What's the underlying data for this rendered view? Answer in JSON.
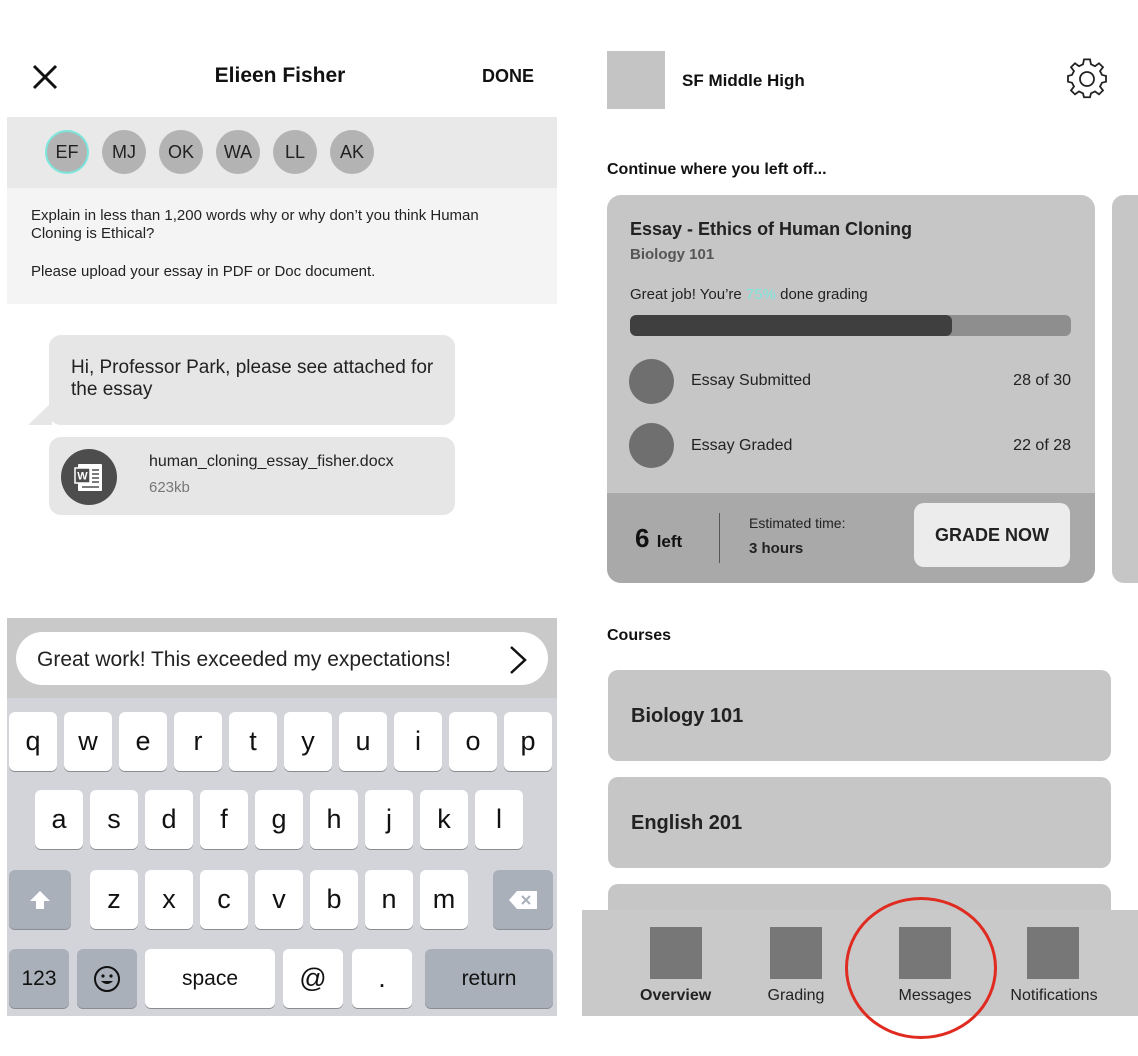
{
  "message_screen": {
    "header": {
      "title": "Elieen Fisher",
      "done_label": "DONE"
    },
    "participants": [
      {
        "initials": "EF",
        "active": true
      },
      {
        "initials": "MJ",
        "active": false
      },
      {
        "initials": "OK",
        "active": false
      },
      {
        "initials": "WA",
        "active": false
      },
      {
        "initials": "LL",
        "active": false
      },
      {
        "initials": "AK",
        "active": false
      }
    ],
    "prompt": {
      "line1": "Explain in less than 1,200 words why or why don’t you think Human Cloning is Ethical?",
      "line2": "Please upload your essay in PDF or Doc document."
    },
    "message": {
      "text": "Hi, Professor Park, please see attached for the essay"
    },
    "attachment": {
      "filename": "human_cloning_essay_fisher.docx",
      "size": "623kb",
      "icon": "word-doc-icon"
    },
    "reply": {
      "value": "Great work! This exceeded my expectations!"
    },
    "keyboard": {
      "row1": [
        "q",
        "w",
        "e",
        "r",
        "t",
        "y",
        "u",
        "i",
        "o",
        "p"
      ],
      "row2": [
        "a",
        "s",
        "d",
        "f",
        "g",
        "h",
        "j",
        "k",
        "l"
      ],
      "row3": [
        "z",
        "x",
        "c",
        "v",
        "b",
        "n",
        "m"
      ],
      "numbers_label": "123",
      "space_label": "space",
      "at_label": "@",
      "period_label": ".",
      "return_label": "return"
    }
  },
  "overview_screen": {
    "school": {
      "name": "SF Middle High"
    },
    "continue_label": "Continue where you left off...",
    "grading_card": {
      "title": "Essay - Ethics of Human Cloning",
      "course": "Biology 101",
      "progress_prefix": "Great job! You’re ",
      "progress_pct": "75%",
      "progress_suffix": " done grading",
      "progress_fraction": 0.73,
      "stats": [
        {
          "label": "Essay Submitted",
          "value": "28 of 30"
        },
        {
          "label": "Essay Graded",
          "value": "22 of 28"
        }
      ],
      "left_count": "6",
      "left_label": "left",
      "estimated_label": "Estimated time:",
      "estimated_value": "3 hours",
      "grade_button": "GRADE NOW"
    },
    "courses_label": "Courses",
    "courses": [
      "Biology 101",
      "English 201"
    ],
    "tabs": [
      {
        "label": "Overview",
        "active": true
      },
      {
        "label": "Grading",
        "active": false
      },
      {
        "label": "Messages",
        "active": false
      },
      {
        "label": "Notifications",
        "active": false
      }
    ],
    "colors": {
      "accent": "#7ce6dc",
      "highlight_ring": "#e02b20"
    }
  }
}
